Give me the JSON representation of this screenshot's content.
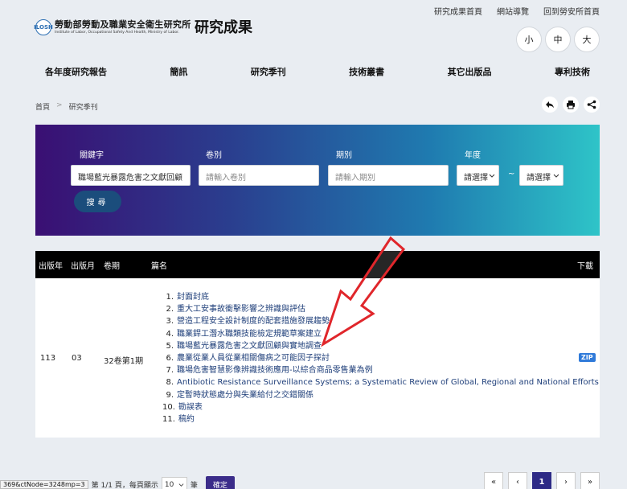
{
  "top_links": [
    "研究成果首頁",
    "網站導覽",
    "回到勞安所首頁"
  ],
  "logo": {
    "mark": "ILOSH",
    "name_cn": "勞動部勞動及職業安全衛生研究所",
    "name_en": "Institute of Labor, Occupational Safety And Health, Ministry of Labor."
  },
  "site_title": "研究成果",
  "font_sizes": [
    "小",
    "中",
    "大"
  ],
  "nav": [
    "各年度研究報告",
    "簡訊",
    "研究季刊",
    "技術叢書",
    "其它出版品",
    "專利技術"
  ],
  "breadcrumb": [
    "首頁",
    "研究季刊"
  ],
  "breadcrumb_sep": ">",
  "search": {
    "keyword_label": "關鍵字",
    "keyword_value": "職場藍光暴露危害之文獻回顧",
    "volume_label": "卷別",
    "volume_placeholder": "請輸入卷別",
    "issue_label": "期別",
    "issue_placeholder": "請輸入期別",
    "year_label": "年度",
    "year_from": "請選擇",
    "year_to": "請選擇",
    "range_sep": "~",
    "button": "搜尋"
  },
  "table": {
    "headers": [
      "出版年",
      "出版月",
      "卷期",
      "篇名",
      "下載"
    ],
    "row": {
      "year": "113",
      "month": "03",
      "volume": "32卷第1期",
      "download": "ZIP",
      "articles": [
        {
          "num": "1.",
          "title": "封面封底"
        },
        {
          "num": "2.",
          "title": "重大工安事故衝擊影響之辨識與評估"
        },
        {
          "num": "3.",
          "title": "營造工程安全設計制度的配套措施發展趨勢"
        },
        {
          "num": "4.",
          "title": "職業銲工潛水職類技能檢定規範草案建立"
        },
        {
          "num": "5.",
          "title": "職場藍光暴露危害之文獻回顧與實地調查"
        },
        {
          "num": "6.",
          "title": "農業從業人員從業相關傷病之可能因子探討"
        },
        {
          "num": "7.",
          "title": "職場危害智慧影像辨識技術應用-以綜合商品零售業為例"
        },
        {
          "num": "8.",
          "title": "Antibiotic Resistance Surveillance Systems; a Systematic Review of Global, Regional and National Efforts"
        },
        {
          "num": "9.",
          "title": "定暫時狀態處分與失業給付之交錯關係"
        },
        {
          "num": "10.",
          "title": "勘誤表"
        },
        {
          "num": "11.",
          "title": "稿約"
        }
      ]
    }
  },
  "pagination": {
    "status_url": "369&ctNode=3248mp=3",
    "page_text": "第 1/1 頁，每頁顯示",
    "per_page": "10",
    "unit": "筆",
    "confirm": "確定",
    "current_page": "1",
    "first": "«",
    "prev": "‹",
    "next": "›",
    "last": "»"
  },
  "colors": {
    "panel_start": "#3a0f73",
    "panel_end": "#2ec4c8",
    "link": "#1f3f7a",
    "accent": "#2d2a86",
    "annotation": "#e0262b"
  }
}
